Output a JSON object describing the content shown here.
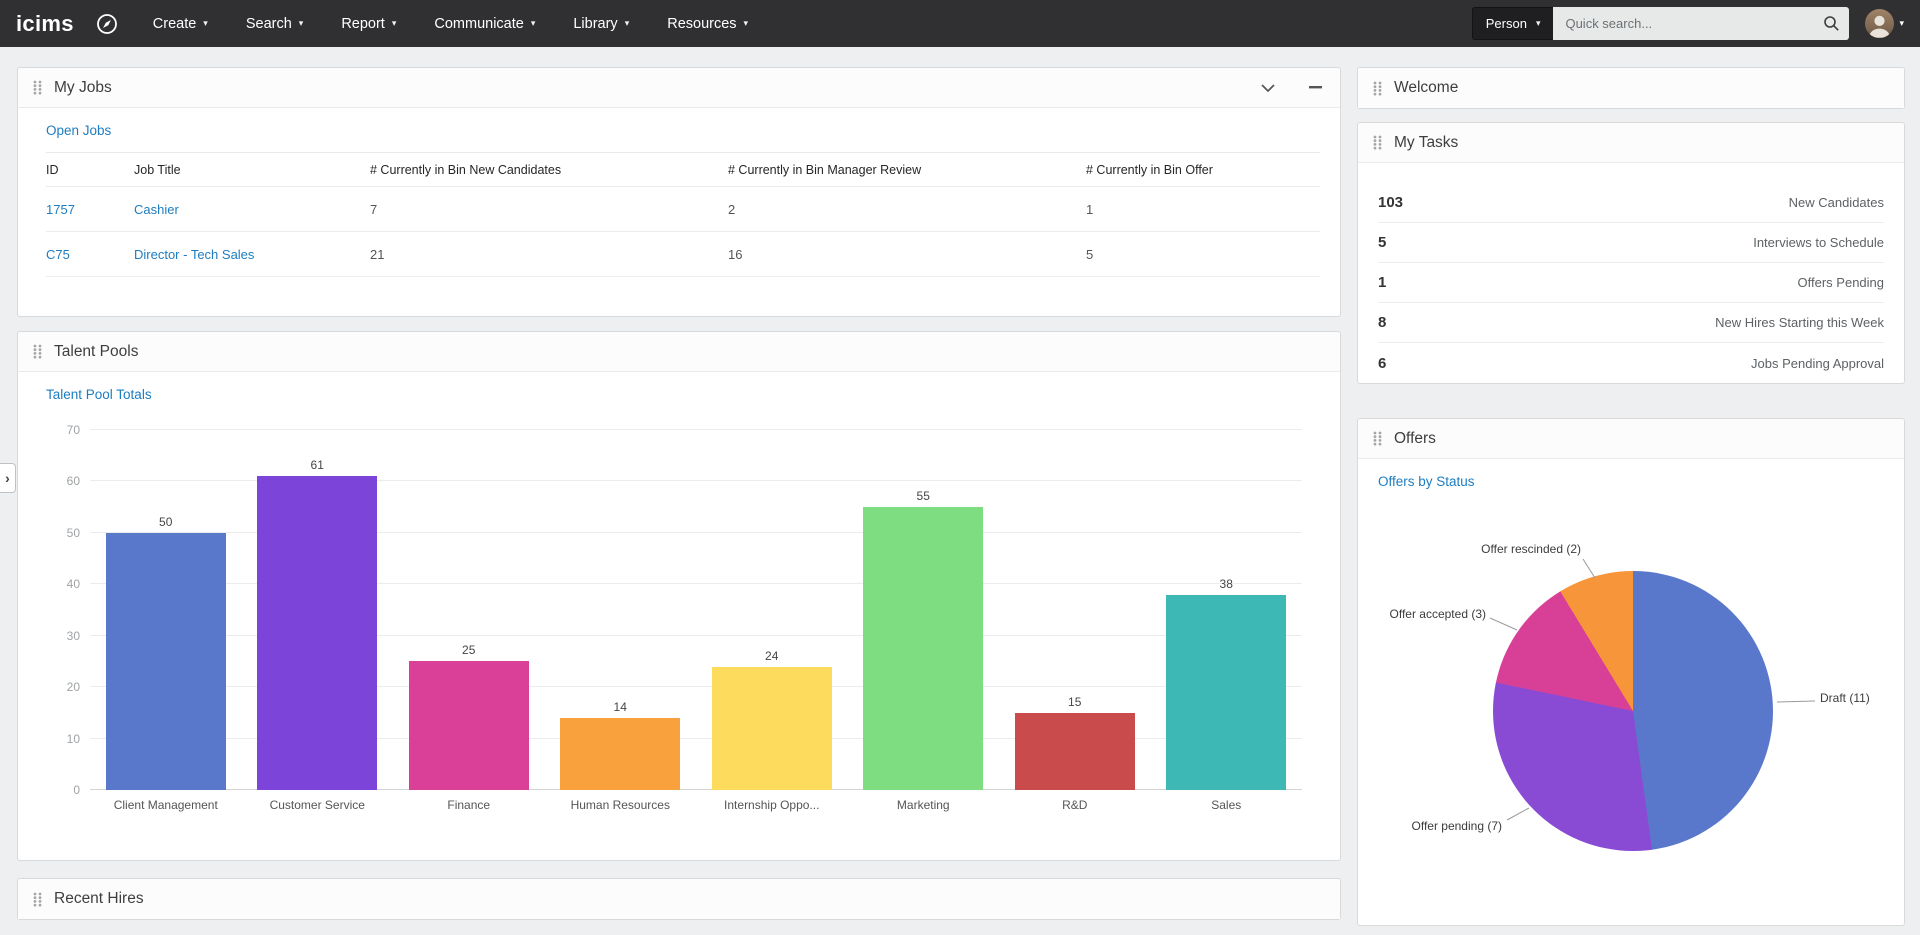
{
  "icons": {
    "caret_down": "▾",
    "chevron_right": "›"
  },
  "topbar": {
    "logo": "icims",
    "menus": [
      {
        "label": "Create"
      },
      {
        "label": "Search"
      },
      {
        "label": "Report"
      },
      {
        "label": "Communicate"
      },
      {
        "label": "Library"
      },
      {
        "label": "Resources"
      }
    ],
    "scope_dropdown_value": "Person",
    "search_placeholder": "Quick search..."
  },
  "panels": {
    "my_jobs": {
      "title": "My Jobs",
      "link": "Open Jobs",
      "table": {
        "headers": [
          "ID",
          "Job Title",
          "# Currently in Bin New Candidates",
          "# Currently in Bin Manager Review",
          "# Currently in Bin Offer"
        ],
        "rows": [
          {
            "id": "1757",
            "job_title": "Cashier",
            "new_candidates": "7",
            "manager_review": "2",
            "offer": "1"
          },
          {
            "id": "C75",
            "job_title": "Director - Tech Sales",
            "new_candidates": "21",
            "manager_review": "16",
            "offer": "5"
          }
        ]
      }
    },
    "talent_pools": {
      "title": "Talent Pools",
      "link": "Talent Pool Totals"
    },
    "recent_hires": {
      "title": "Recent Hires"
    },
    "welcome": {
      "title": "Welcome"
    },
    "my_tasks": {
      "title": "My Tasks",
      "items": [
        {
          "count": "103",
          "label": "New Candidates"
        },
        {
          "count": "5",
          "label": "Interviews to Schedule"
        },
        {
          "count": "1",
          "label": "Offers Pending"
        },
        {
          "count": "8",
          "label": "New Hires Starting this Week"
        },
        {
          "count": "6",
          "label": "Jobs Pending Approval"
        }
      ]
    },
    "offers": {
      "title": "Offers",
      "link": "Offers by Status"
    }
  },
  "chart_data": [
    {
      "type": "bar",
      "title": "Talent Pool Totals",
      "categories": [
        "Client Management",
        "Customer Service",
        "Finance",
        "Human Resources",
        "Internship Oppo...",
        "Marketing",
        "R&D",
        "Sales"
      ],
      "values": [
        50,
        61,
        25,
        14,
        24,
        55,
        15,
        38
      ],
      "colors": [
        "#5a78cb",
        "#7d44da",
        "#da4097",
        "#f9a13d",
        "#fcdb5d",
        "#7edc81",
        "#c94b4c",
        "#3db8b5"
      ],
      "xlabel": "",
      "ylabel": "",
      "ylim": [
        0,
        70
      ],
      "yticks": [
        0,
        10,
        20,
        30,
        40,
        50,
        60,
        70
      ],
      "grid": true,
      "legend": false
    },
    {
      "type": "pie",
      "title": "Offers by Status",
      "direction": "clockwise",
      "start_angle_deg": 0,
      "total": 23,
      "slices": [
        {
          "label": "Draft",
          "value": 11,
          "display": "Draft (11)",
          "color": "#5a78cb"
        },
        {
          "label": "Offer pending",
          "value": 7,
          "display": "Offer pending (7)",
          "color": "#8a4bd4"
        },
        {
          "label": "Offer accepted",
          "value": 3,
          "display": "Offer accepted (3)",
          "color": "#d84098"
        },
        {
          "label": "Offer rescinded",
          "value": 2,
          "display": "Offer rescinded (2)",
          "color": "#f7953a"
        }
      ]
    }
  ]
}
